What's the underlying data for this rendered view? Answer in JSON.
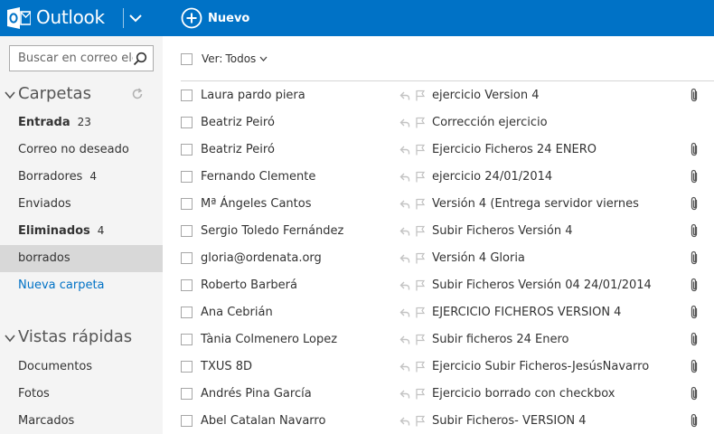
{
  "app": {
    "logo_text": "Outlook",
    "brand_color": "#0072c6",
    "new_label": "Nuevo"
  },
  "sidebar": {
    "search_placeholder": "Buscar en correo electrónico",
    "folders_title": "Carpetas",
    "folders": [
      {
        "name": "Entrada",
        "count": "23",
        "bold": true
      },
      {
        "name": "Correo no deseado",
        "count": "",
        "bold": false
      },
      {
        "name": "Borradores",
        "count": "4",
        "bold": false
      },
      {
        "name": "Enviados",
        "count": "",
        "bold": false
      },
      {
        "name": "Eliminados",
        "count": "4",
        "bold": true
      },
      {
        "name": "borrados",
        "count": "",
        "bold": false,
        "selected": true
      },
      {
        "name": "Nueva carpeta",
        "count": "",
        "bold": false,
        "link": true
      }
    ],
    "quick_title": "Vistas rápidas",
    "quick_views": [
      {
        "name": "Documentos"
      },
      {
        "name": "Fotos"
      },
      {
        "name": "Marcados"
      }
    ]
  },
  "toolbar": {
    "filter_label": "Ver:",
    "filter_value": "Todos"
  },
  "messages": [
    {
      "sender": "Laura pardo piera",
      "subject": "ejercicio Version 4",
      "attachment": true
    },
    {
      "sender": "Beatriz Peiró",
      "subject": "Corrección ejercicio",
      "attachment": false
    },
    {
      "sender": "Beatriz Peiró",
      "subject": "Ejercicio Ficheros 24 ENERO",
      "attachment": true
    },
    {
      "sender": "Fernando Clemente",
      "subject": "ejercicio 24/01/2014",
      "attachment": true
    },
    {
      "sender": "Mª Ángeles Cantos",
      "subject": "Versión 4 (Entrega servidor viernes",
      "attachment": true
    },
    {
      "sender": "Sergio Toledo Fernández",
      "subject": "Subir Ficheros Versión 4",
      "attachment": true
    },
    {
      "sender": "gloria@ordenata.org",
      "subject": "Versión 4 Gloria",
      "attachment": true
    },
    {
      "sender": "Roberto Barberá",
      "subject": "Subir Ficheros Versión 04 24/01/2014",
      "attachment": true
    },
    {
      "sender": "Ana Cebrián",
      "subject": "EJERCICIO FICHEROS VERSION 4",
      "attachment": true
    },
    {
      "sender": "Tània Colmenero Lopez",
      "subject": "Subir ficheros 24 Enero",
      "attachment": true
    },
    {
      "sender": "TXUS 8D",
      "subject": "Ejercicio Subir Ficheros-JesúsNavarro",
      "attachment": true
    },
    {
      "sender": "Andrés Pina García",
      "subject": "Ejercicio borrado con checkbox",
      "attachment": true
    },
    {
      "sender": "Abel Catalan Navarro",
      "subject": "Subir Ficheros- VERSIÓN 4",
      "attachment": true
    }
  ]
}
